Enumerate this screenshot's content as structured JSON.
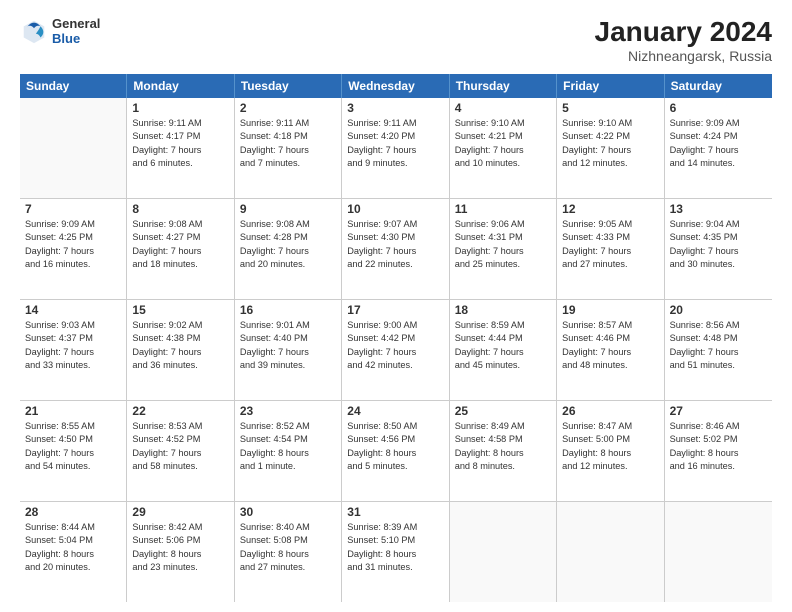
{
  "header": {
    "logo_general": "General",
    "logo_blue": "Blue",
    "month_year": "January 2024",
    "location": "Nizhneangarsk, Russia"
  },
  "days_of_week": [
    "Sunday",
    "Monday",
    "Tuesday",
    "Wednesday",
    "Thursday",
    "Friday",
    "Saturday"
  ],
  "weeks": [
    [
      {
        "day": "",
        "info": ""
      },
      {
        "day": "1",
        "info": "Sunrise: 9:11 AM\nSunset: 4:17 PM\nDaylight: 7 hours\nand 6 minutes."
      },
      {
        "day": "2",
        "info": "Sunrise: 9:11 AM\nSunset: 4:18 PM\nDaylight: 7 hours\nand 7 minutes."
      },
      {
        "day": "3",
        "info": "Sunrise: 9:11 AM\nSunset: 4:20 PM\nDaylight: 7 hours\nand 9 minutes."
      },
      {
        "day": "4",
        "info": "Sunrise: 9:10 AM\nSunset: 4:21 PM\nDaylight: 7 hours\nand 10 minutes."
      },
      {
        "day": "5",
        "info": "Sunrise: 9:10 AM\nSunset: 4:22 PM\nDaylight: 7 hours\nand 12 minutes."
      },
      {
        "day": "6",
        "info": "Sunrise: 9:09 AM\nSunset: 4:24 PM\nDaylight: 7 hours\nand 14 minutes."
      }
    ],
    [
      {
        "day": "7",
        "info": "Sunrise: 9:09 AM\nSunset: 4:25 PM\nDaylight: 7 hours\nand 16 minutes."
      },
      {
        "day": "8",
        "info": "Sunrise: 9:08 AM\nSunset: 4:27 PM\nDaylight: 7 hours\nand 18 minutes."
      },
      {
        "day": "9",
        "info": "Sunrise: 9:08 AM\nSunset: 4:28 PM\nDaylight: 7 hours\nand 20 minutes."
      },
      {
        "day": "10",
        "info": "Sunrise: 9:07 AM\nSunset: 4:30 PM\nDaylight: 7 hours\nand 22 minutes."
      },
      {
        "day": "11",
        "info": "Sunrise: 9:06 AM\nSunset: 4:31 PM\nDaylight: 7 hours\nand 25 minutes."
      },
      {
        "day": "12",
        "info": "Sunrise: 9:05 AM\nSunset: 4:33 PM\nDaylight: 7 hours\nand 27 minutes."
      },
      {
        "day": "13",
        "info": "Sunrise: 9:04 AM\nSunset: 4:35 PM\nDaylight: 7 hours\nand 30 minutes."
      }
    ],
    [
      {
        "day": "14",
        "info": "Sunrise: 9:03 AM\nSunset: 4:37 PM\nDaylight: 7 hours\nand 33 minutes."
      },
      {
        "day": "15",
        "info": "Sunrise: 9:02 AM\nSunset: 4:38 PM\nDaylight: 7 hours\nand 36 minutes."
      },
      {
        "day": "16",
        "info": "Sunrise: 9:01 AM\nSunset: 4:40 PM\nDaylight: 7 hours\nand 39 minutes."
      },
      {
        "day": "17",
        "info": "Sunrise: 9:00 AM\nSunset: 4:42 PM\nDaylight: 7 hours\nand 42 minutes."
      },
      {
        "day": "18",
        "info": "Sunrise: 8:59 AM\nSunset: 4:44 PM\nDaylight: 7 hours\nand 45 minutes."
      },
      {
        "day": "19",
        "info": "Sunrise: 8:57 AM\nSunset: 4:46 PM\nDaylight: 7 hours\nand 48 minutes."
      },
      {
        "day": "20",
        "info": "Sunrise: 8:56 AM\nSunset: 4:48 PM\nDaylight: 7 hours\nand 51 minutes."
      }
    ],
    [
      {
        "day": "21",
        "info": "Sunrise: 8:55 AM\nSunset: 4:50 PM\nDaylight: 7 hours\nand 54 minutes."
      },
      {
        "day": "22",
        "info": "Sunrise: 8:53 AM\nSunset: 4:52 PM\nDaylight: 7 hours\nand 58 minutes."
      },
      {
        "day": "23",
        "info": "Sunrise: 8:52 AM\nSunset: 4:54 PM\nDaylight: 8 hours\nand 1 minute."
      },
      {
        "day": "24",
        "info": "Sunrise: 8:50 AM\nSunset: 4:56 PM\nDaylight: 8 hours\nand 5 minutes."
      },
      {
        "day": "25",
        "info": "Sunrise: 8:49 AM\nSunset: 4:58 PM\nDaylight: 8 hours\nand 8 minutes."
      },
      {
        "day": "26",
        "info": "Sunrise: 8:47 AM\nSunset: 5:00 PM\nDaylight: 8 hours\nand 12 minutes."
      },
      {
        "day": "27",
        "info": "Sunrise: 8:46 AM\nSunset: 5:02 PM\nDaylight: 8 hours\nand 16 minutes."
      }
    ],
    [
      {
        "day": "28",
        "info": "Sunrise: 8:44 AM\nSunset: 5:04 PM\nDaylight: 8 hours\nand 20 minutes."
      },
      {
        "day": "29",
        "info": "Sunrise: 8:42 AM\nSunset: 5:06 PM\nDaylight: 8 hours\nand 23 minutes."
      },
      {
        "day": "30",
        "info": "Sunrise: 8:40 AM\nSunset: 5:08 PM\nDaylight: 8 hours\nand 27 minutes."
      },
      {
        "day": "31",
        "info": "Sunrise: 8:39 AM\nSunset: 5:10 PM\nDaylight: 8 hours\nand 31 minutes."
      },
      {
        "day": "",
        "info": ""
      },
      {
        "day": "",
        "info": ""
      },
      {
        "day": "",
        "info": ""
      }
    ]
  ]
}
